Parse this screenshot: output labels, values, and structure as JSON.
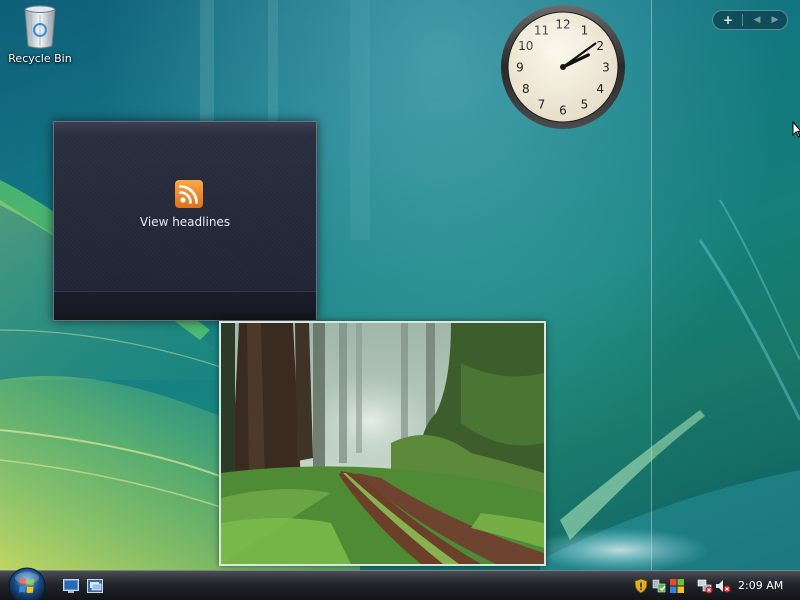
{
  "desktop": {
    "icons": [
      {
        "label": "Recycle Bin",
        "icon": "recycle-bin-icon"
      }
    ]
  },
  "sidebar": {
    "controls": {
      "add_label": "+",
      "prev_icon": "chevron-left-icon",
      "next_icon": "chevron-right-icon"
    }
  },
  "clock_gadget": {
    "numerals": [
      "12",
      "1",
      "2",
      "3",
      "4",
      "5",
      "6",
      "7",
      "8",
      "9",
      "10",
      "11"
    ],
    "time": {
      "hours": 2,
      "minutes": 9
    }
  },
  "feed_gadget": {
    "icon": "rss-feed-icon",
    "label": "View headlines"
  },
  "slideshow_gadget": {
    "image": "forest-path-photo"
  },
  "taskbar": {
    "start_button": "windows-start-orb-icon",
    "quick_launch": [
      {
        "icon": "show-desktop-icon"
      },
      {
        "icon": "switch-windows-icon"
      }
    ],
    "tray": {
      "icons": [
        "security-shield-icon",
        "sync-icon",
        "windows-flag-icon",
        "network-icon",
        "volume-muted-icon"
      ],
      "time": "2:09 AM"
    }
  },
  "colors": {
    "wallpaper_primary": "#137a86",
    "taskbar_bg": "#1a1c20",
    "rss_orange": "#f08a24",
    "feed_bg": "#232838"
  }
}
